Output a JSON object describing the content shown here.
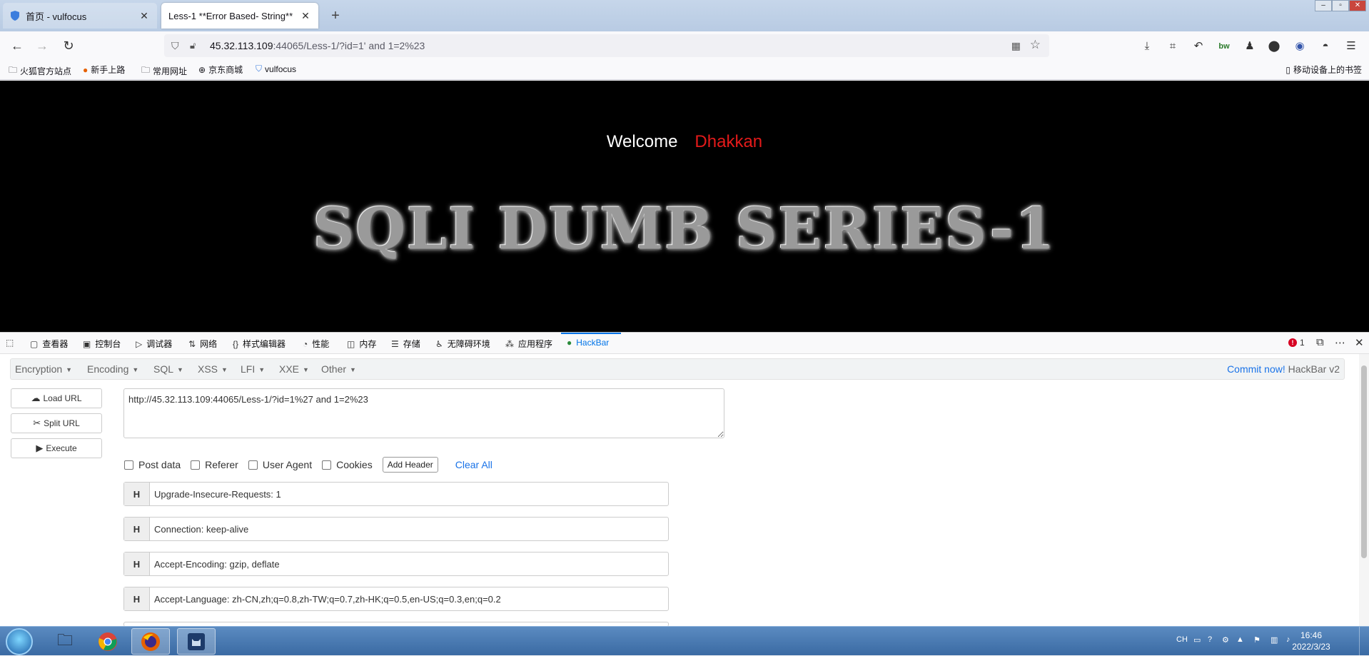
{
  "tabs": [
    {
      "title": "首页 - vulfocus",
      "active": false
    },
    {
      "title": "Less-1 **Error Based- String**",
      "active": true
    }
  ],
  "url": {
    "host": "45.32.113.109",
    "rest": ":44065/Less-1/?id=1' and 1=2%23"
  },
  "bookmarks": [
    "火狐官方站点",
    "新手上路",
    "常用网址",
    "京东商城",
    "vulfocus"
  ],
  "mobile_bookmarks": "移动设备上的书签",
  "page": {
    "welcome": "Welcome",
    "name": "Dhakkan",
    "banner": "SQLI DUMB SERIES-1",
    "name_color": "#e31a1a"
  },
  "devtools": {
    "tabs": [
      "查看器",
      "控制台",
      "调试器",
      "网络",
      "样式编辑器",
      "性能",
      "内存",
      "存储",
      "无障碍环境",
      "应用程序",
      "HackBar"
    ],
    "error_count": "1"
  },
  "hackbar": {
    "menus": [
      "Encryption",
      "Encoding",
      "SQL",
      "XSS",
      "LFI",
      "XXE",
      "Other"
    ],
    "commit_link": "Commit now!",
    "version": "HackBar v2",
    "buttons": [
      "Load URL",
      "Split URL",
      "Execute"
    ],
    "url_value": "http://45.32.113.109:44065/Less-1/?id=1%27 and 1=2%23",
    "options": [
      "Post data",
      "Referer",
      "User Agent",
      "Cookies"
    ],
    "add_header": "Add Header",
    "clear_all": "Clear All",
    "headers": [
      "Upgrade-Insecure-Requests: 1",
      "Connection: keep-alive",
      "Accept-Encoding: gzip, deflate",
      "Accept-Language: zh-CN,zh;q=0.8,zh-TW;q=0.7,zh-HK;q=0.5,en-US;q=0.3,en;q=0.2"
    ]
  },
  "taskbar": {
    "lang": "CH",
    "time": "16:46",
    "date": "2022/3/23"
  }
}
